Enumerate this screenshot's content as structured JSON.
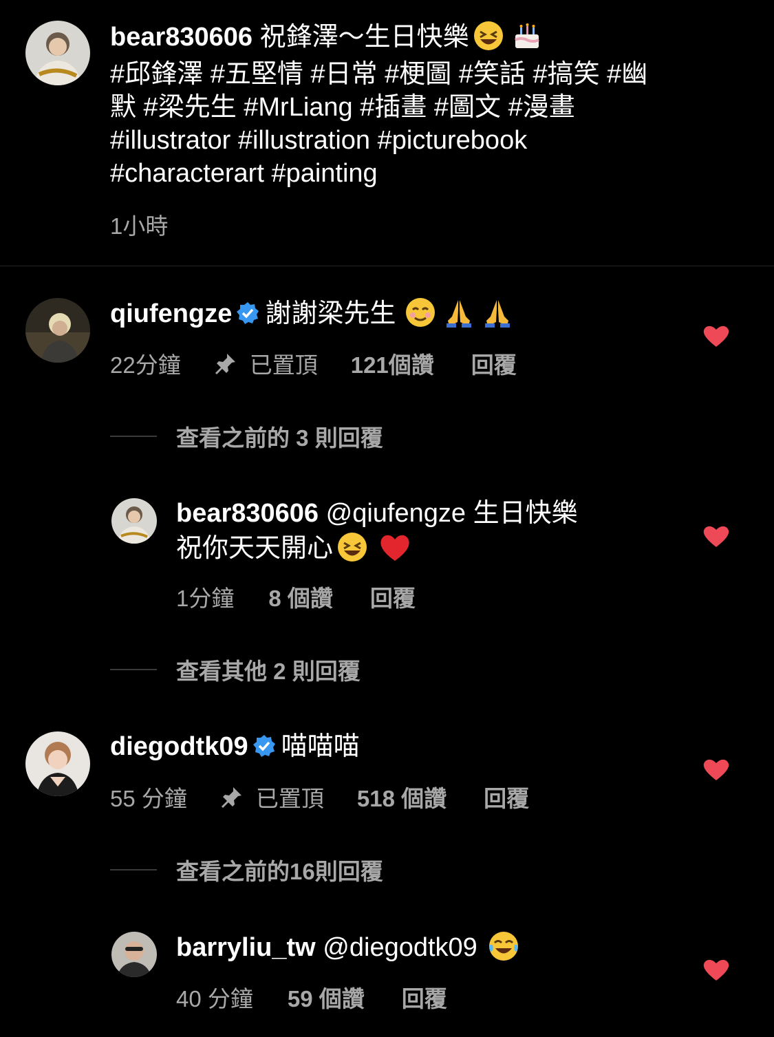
{
  "caption": {
    "username": "bear830606",
    "text_line1": "祝鋒澤～生日快樂",
    "hashtags_line2": "#邱鋒澤 #五堅情 #日常 #梗圖 #笑話 #搞笑 #幽",
    "hashtags_line3": "默 #梁先生 #MrLiang #插畫 #圖文 #漫畫",
    "hashtags_line4": "#illustrator #illustration #picturebook",
    "hashtags_line5": "#characterart #painting",
    "time": "1小時",
    "emojis": [
      "laughing-face",
      "birthday-cake"
    ]
  },
  "comments": [
    {
      "username": "qiufengze",
      "verified": true,
      "text": "謝謝梁先生",
      "emojis": [
        "smiling-face",
        "folded-hands",
        "folded-hands"
      ],
      "time": "22分鐘",
      "pinned_label": "已置頂",
      "likes": "121個讚",
      "reply": "回覆",
      "view_replies": "查看之前的 3 則回覆",
      "more_replies": "查看其他 2 則回覆",
      "replies": [
        {
          "username": "bear830606",
          "mention": "@qiufengze",
          "text_line1": "生日快樂",
          "text_line2": "祝你天天開心",
          "emojis": [
            "laughing-face",
            "red-heart"
          ],
          "time": "1分鐘",
          "likes": "8 個讚",
          "reply": "回覆"
        }
      ]
    },
    {
      "username": "diegodtk09",
      "verified": true,
      "text": "喵喵喵",
      "time": "55 分鐘",
      "pinned_label": "已置頂",
      "likes": "518 個讚",
      "reply": "回覆",
      "view_replies": "查看之前的16則回覆",
      "replies": [
        {
          "username": "barryliu_tw",
          "mention": "@diegodtk09",
          "emojis": [
            "tears-of-joy"
          ],
          "time": "40 分鐘",
          "likes": "59 個讚",
          "reply": "回覆"
        }
      ]
    }
  ],
  "colors": {
    "background": "#000000",
    "text": "#ffffff",
    "meta": "#a8a8a8",
    "heart": "#ed4956",
    "verified": "#3897f0"
  }
}
